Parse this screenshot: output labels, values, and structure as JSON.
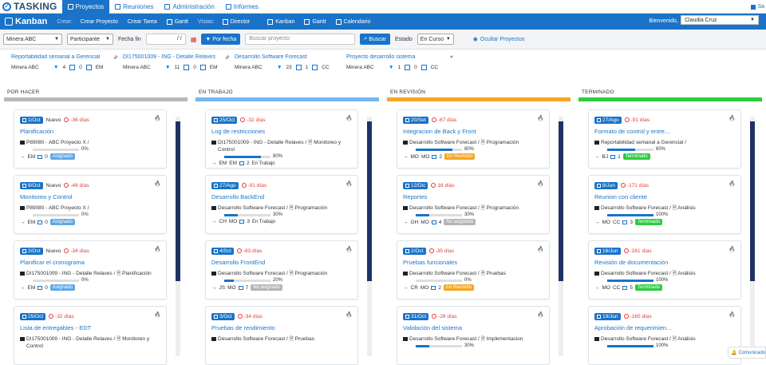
{
  "app": {
    "name": "TASKING",
    "tabs": [
      "Proyectos",
      "Reuniones",
      "Administración",
      "Informes"
    ],
    "active_tab": 0,
    "topright": "Sa"
  },
  "navbar": {
    "title": "Kanban",
    "crear_label": "Crear:",
    "crear_links": [
      "Crear Proyecto",
      "Crear Tarea",
      "Gantt"
    ],
    "vistas_label": "Vistas:",
    "vistas_links": [
      "Director",
      "Kanban",
      "Gantt",
      "Calendario"
    ],
    "welcome": "Bienvenido,",
    "user": "Claudia Cruz"
  },
  "filters": {
    "company": "Minera ABC",
    "role": "Participante",
    "fecha_label": "Fecha fin",
    "date_placeholder": "/ /",
    "por_fecha": "Por fecha",
    "search_placeholder": "Buscar proyecto",
    "buscar": "Buscar",
    "estado_label": "Estado",
    "estado": "En Curso",
    "ocultar": "Ocultar Proyectos"
  },
  "favorites": [
    {
      "title": "Reportabilidad semanal a Gerencial",
      "company": "Minera ABC",
      "filters": "4",
      "comments": "0",
      "user": "EM",
      "pin": "🖈"
    },
    {
      "title": "DI175001009 - ING - Detalle Relaves",
      "company": "Minera ABC",
      "filters": "11",
      "comments": "0",
      "user": "EM",
      "pin": "🖈"
    },
    {
      "title": "Desarrollo Software Forecast",
      "company": "Minera ABC",
      "filters": "23",
      "comments": "1",
      "user": "CC",
      "pin": ""
    },
    {
      "title": "Proyecto desarrollo sistema",
      "company": "Minera ABC",
      "filters": "1",
      "comments": "0",
      "user": "CC",
      "pin": "●"
    }
  ],
  "columns": [
    {
      "title": "POR HACER",
      "color": "#b8b8b8",
      "cards": [
        {
          "date": "1/Oct",
          "nuevo": "Nuevo",
          "late": "-36 días",
          "title": "Planificación",
          "project": "P89080 - ABC Proyecto X /",
          "pct": "0%",
          "progress": 0,
          "from": "EM",
          "to": "",
          "comments": "0",
          "badge": "Asignado",
          "badge_color": "#5fa8e8"
        },
        {
          "date": "8/Oct",
          "nuevo": "Nuevo",
          "late": "-48 días",
          "title": "Monitoreo y Control",
          "project": "P89080 - ABC Proyecto X /",
          "pct": "0%",
          "progress": 0,
          "from": "EM",
          "to": "",
          "comments": "0",
          "badge": "Asignado",
          "badge_color": "#5fa8e8"
        },
        {
          "date": "2/Oct",
          "nuevo": "Nuevo",
          "late": "-34 días",
          "title": "Planificar el cronograma",
          "project": "DI175001009 - ING - Detalle Relaves / 🗎 Planificación",
          "pct": "0%",
          "progress": 0,
          "from": "EM",
          "to": "",
          "comments": "0",
          "badge": "Asignado",
          "badge_color": "#5fa8e8"
        },
        {
          "date": "25/Oct",
          "nuevo": "",
          "late": "-32 días",
          "title": "Lista de entregables - EDT",
          "project": "DI175001009 - ING - Detalle Relaves / 🗎 Monitoreo y Control",
          "pct": "",
          "progress": 0,
          "from": "",
          "to": "",
          "comments": "",
          "badge": "",
          "badge_color": ""
        }
      ]
    },
    {
      "title": "EN TRABAJO",
      "color": "#74b7f2",
      "cards": [
        {
          "date": "25/Oct",
          "nuevo": "",
          "late": "-32 días",
          "title": "Log de restricciones",
          "project": "DI175001009 - ING - Detalle Relaves / 🗎 Monitoreo y Control",
          "pct": "80%",
          "progress": 80,
          "from": "EM",
          "to": "EM",
          "comments": "2",
          "badge": "En Trabajo",
          "badge_color": ""
        },
        {
          "date": "27/Ago",
          "nuevo": "",
          "late": "-91 días",
          "title": "Desarrollo BackEnd",
          "project": "Desarrollo Software Forecast / 🗎 Programación",
          "pct": "30%",
          "progress": 30,
          "from": "MO",
          "to": "CH",
          "comments": "3",
          "badge": "En Trabajo",
          "badge_color": ""
        },
        {
          "date": "4/Sct",
          "nuevo": "",
          "late": "-83 días",
          "title": "Desarrollo FrontEnd",
          "project": "Desarrollo Software Forecast / 🗎 Programación",
          "pct": "20%",
          "progress": 20,
          "from": "MO",
          "to": "JS",
          "comments": "7",
          "badge": "No asignado",
          "badge_color": "#b5b5b5"
        },
        {
          "date": "3/Oct",
          "nuevo": "",
          "late": "-34 días",
          "title": "Pruebas de rendimiento",
          "project": "Desarrollo Software Forecast / 🗎 Pruebas",
          "pct": "",
          "progress": 0,
          "from": "",
          "to": "",
          "comments": "",
          "badge": "",
          "badge_color": ""
        }
      ]
    },
    {
      "title": "EN REVISIÓN",
      "color": "#f6a623",
      "cards": [
        {
          "date": "20/Set",
          "nuevo": "",
          "late": "-67 días",
          "title": "Integracion de Back y Front",
          "project": "Desarrollo Software Forecast / 🗎 Programación",
          "pct": "80%",
          "progress": 80,
          "from": "MO",
          "to": "MO",
          "comments": "2",
          "badge": "En Revisión",
          "badge_color": "#f6a623"
        },
        {
          "date": "12/Dic",
          "nuevo": "",
          "late": "16 días",
          "title": "Reportes",
          "project": "Desarrollo Software Forecast / 🗎 Programación",
          "pct": "30%",
          "progress": 30,
          "from": "MO",
          "to": "GH",
          "comments": "4",
          "badge": "No asignado",
          "badge_color": "#b5b5b5"
        },
        {
          "date": "2/Oct",
          "nuevo": "",
          "late": "-35 días",
          "title": "Pruebas funcionales",
          "project": "Desarrollo Software Forecast / 🗎 Pruebas",
          "pct": "0%",
          "progress": 0,
          "from": "MO",
          "to": "CR",
          "comments": "2",
          "badge": "En Revisión",
          "badge_color": "#f6a623"
        },
        {
          "date": "31/Oct",
          "nuevo": "",
          "late": "-26 días",
          "title": "Validación del sistema",
          "project": "Desarrollo Software Forecast / 🗎 Implementacion",
          "pct": "30%",
          "progress": 30,
          "from": "",
          "to": "",
          "comments": "",
          "badge": "",
          "badge_color": ""
        }
      ]
    },
    {
      "title": "TERMINADO",
      "color": "#2ecc40",
      "cards": [
        {
          "date": "27/Ago",
          "nuevo": "",
          "late": "-91 días",
          "title": "Formato de control y entre...",
          "project": "Reportabilidad semanal a Gerencial /",
          "pct": "60%",
          "progress": 60,
          "from": "",
          "to": "BJ",
          "comments": "1",
          "badge": "Terminado",
          "badge_color": "#2ecc40"
        },
        {
          "date": "8/Jun",
          "nuevo": "",
          "late": "-171 días",
          "title": "Reunion con cliente",
          "project": "Desarrollo Software Forecast / 🗎 Análisis",
          "pct": "100%",
          "progress": 100,
          "from": "CC",
          "to": "MO",
          "comments": "3",
          "badge": "Terminado",
          "badge_color": "#2ecc40"
        },
        {
          "date": "16/Jun",
          "nuevo": "",
          "late": "-161 días",
          "title": "Revisión de documentación",
          "project": "Desarrollo Software Forecast / 🗎 Análisis",
          "pct": "100%",
          "progress": 100,
          "from": "CC",
          "to": "MO",
          "comments": "5",
          "badge": "Terminado",
          "badge_color": "#2ecc40"
        },
        {
          "date": "19/Jun",
          "nuevo": "",
          "late": "-160 días",
          "title": "Aprobación de requerimien...",
          "project": "Desarrollo Software Forecast / 🗎 Análisis",
          "pct": "100%",
          "progress": 100,
          "from": "",
          "to": "",
          "comments": "",
          "badge": "",
          "badge_color": ""
        }
      ]
    }
  ],
  "chat": "Comunicado"
}
